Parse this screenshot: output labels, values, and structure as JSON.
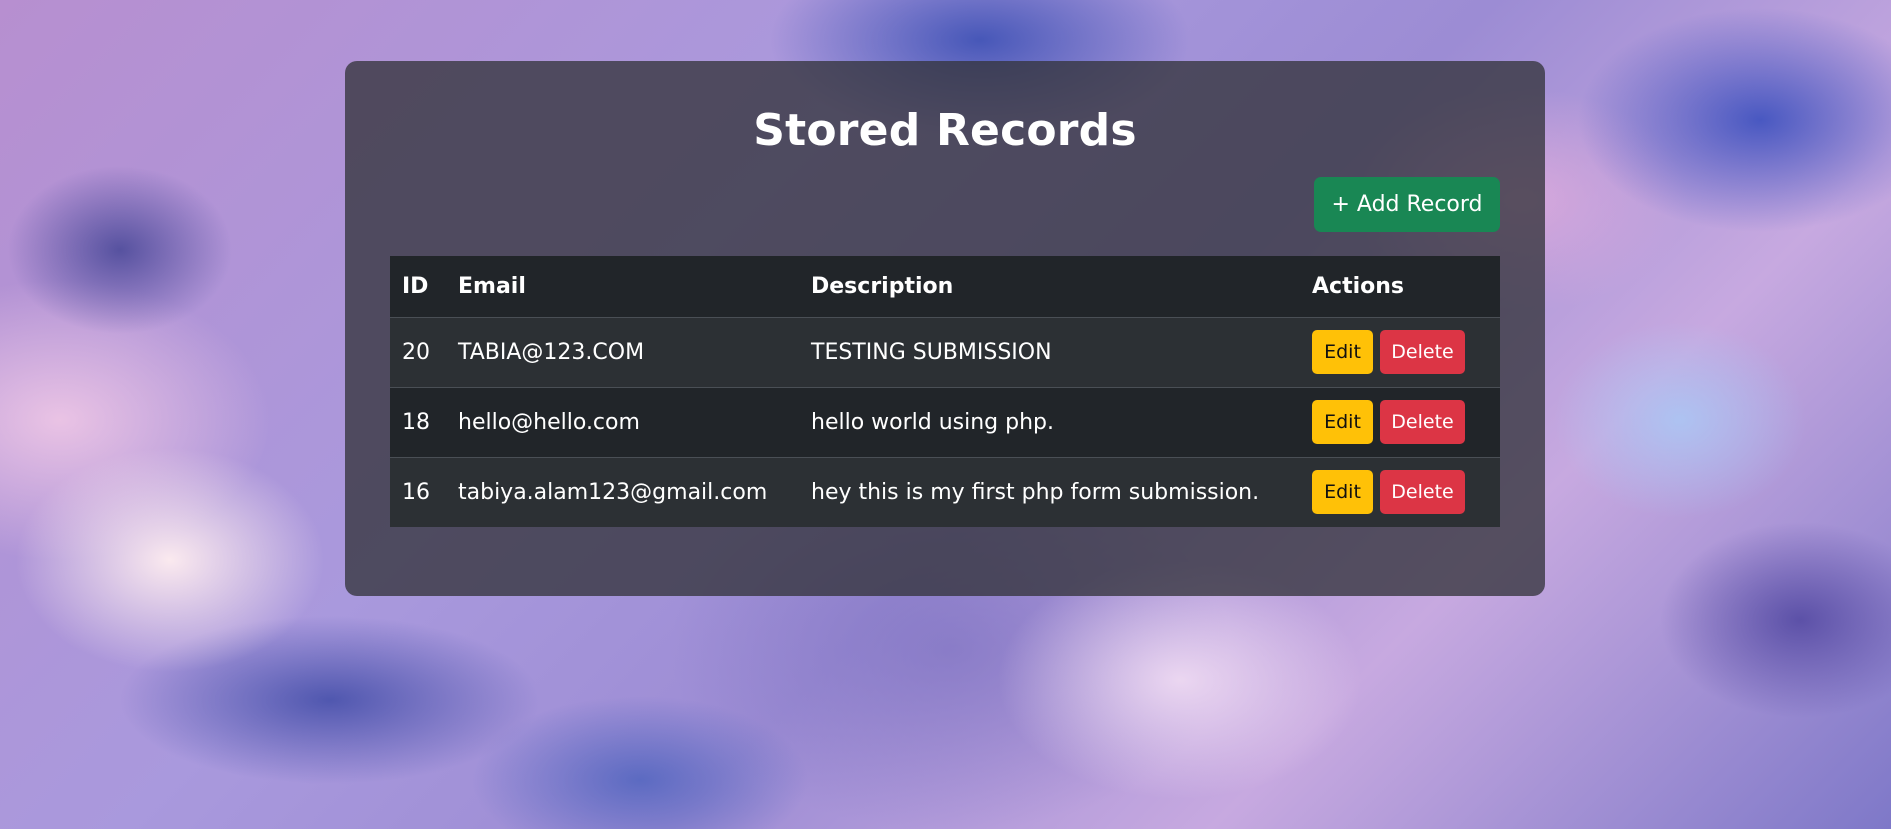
{
  "page": {
    "title": "Stored Records",
    "add_button_label": "+ Add Record"
  },
  "table": {
    "headers": {
      "id": "ID",
      "email": "Email",
      "description": "Description",
      "actions": "Actions"
    },
    "rows": [
      {
        "id": "20",
        "email": "TABIA@123.COM",
        "description": "TESTING SUBMISSION",
        "edit_label": "Edit",
        "delete_label": "Delete"
      },
      {
        "id": "18",
        "email": "hello@hello.com",
        "description": "hello world using php.",
        "edit_label": "Edit",
        "delete_label": "Delete"
      },
      {
        "id": "16",
        "email": "tabiya.alam123@gmail.com",
        "description": "hey this is my first php form submission.",
        "edit_label": "Edit",
        "delete_label": "Delete"
      }
    ]
  },
  "colors": {
    "add_button": "#198754",
    "edit_button": "#ffc107",
    "delete_button": "#dc3545",
    "table_header": "#212529"
  }
}
